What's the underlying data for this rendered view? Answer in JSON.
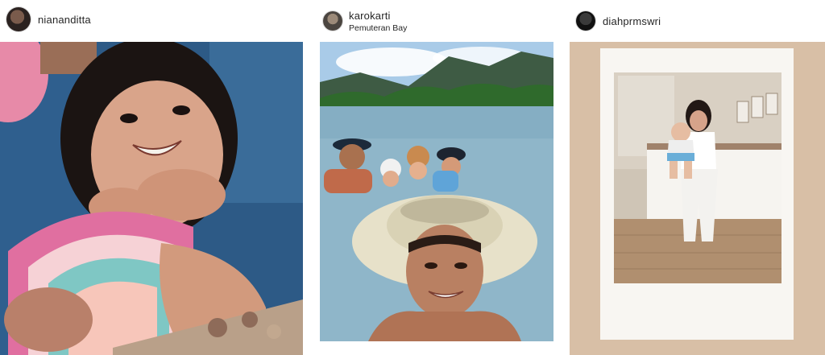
{
  "posts": [
    {
      "username": "niananditta",
      "location": "",
      "photo": "child-portrait"
    },
    {
      "username": "karokarti",
      "location": "Pemuteran Bay",
      "photo": "beach-selfie"
    },
    {
      "username": "diahprmswri",
      "location": "",
      "photo": "instax-mother-baby"
    }
  ],
  "colors": {
    "text": "#262626",
    "sea": "#8fb6c9",
    "sky": "#a9cbe8",
    "instax_frame": "#f8f6f2",
    "backdrop": "#d8bfa6"
  }
}
